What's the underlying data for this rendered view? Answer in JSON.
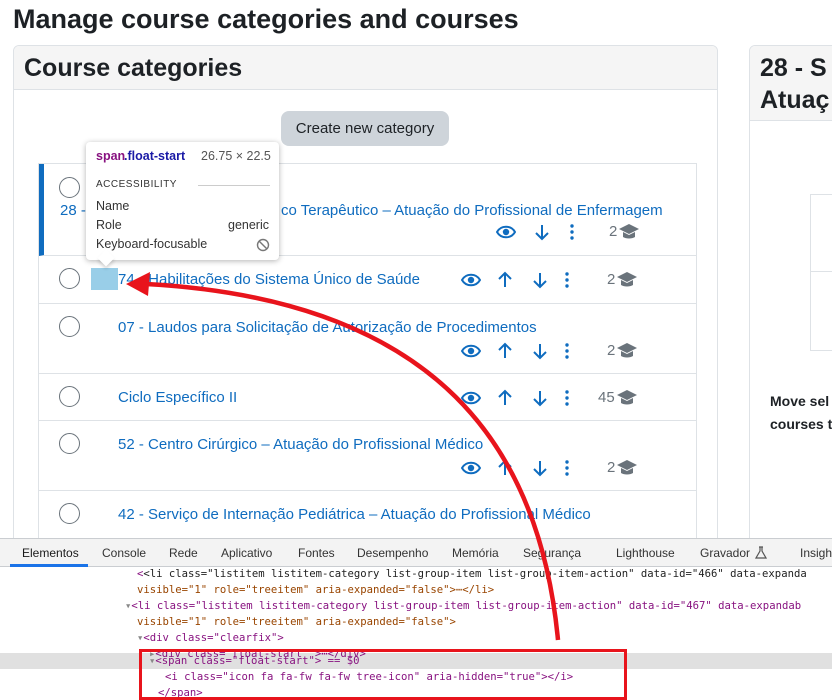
{
  "page": {
    "title": "Manage course categories and courses"
  },
  "categories_panel": {
    "heading": "Course categories",
    "create_button": "Create new category",
    "rows": [
      {
        "name": "28 - Sistematização do Cuidado Terapêutico – Atuação do Profissional de Enfermagem",
        "name_visible_a": "28 -",
        "name_visible_b": "co Terapêutico – Atuação do Profissional de Enfermagem",
        "count": "2",
        "active": true
      },
      {
        "name": "74 - Habilitações do Sistema Único de Saúde",
        "name_visible_a": "74",
        "name_visible_b": "- Habilitações do Sistema Único de Saúde",
        "count": "2"
      },
      {
        "name": "07 - Laudos para Solicitação de Autorização de Procedimentos",
        "count": "2"
      },
      {
        "name": "Ciclo Específico II",
        "count": "45"
      },
      {
        "name": "52 - Centro Cirúrgico – Atuação do Profissional Médico",
        "count": "2"
      },
      {
        "name": "42 - Serviço de Internação Pediátrica – Atuação do Profissional Médico",
        "count": ""
      }
    ]
  },
  "right_panel": {
    "title_line1": "28 - S",
    "title_line2": "Atuaç",
    "move_label_line1": "Move sel",
    "move_label_line2": "courses t"
  },
  "inspect_tooltip": {
    "selector_tag": "span",
    "selector_class": ".float-start",
    "size": "26.75 × 22.5",
    "section": "ACCESSIBILITY",
    "name_label": "Name",
    "role_label": "Role",
    "role_value": "generic",
    "focusable_label": "Keyboard-focusable"
  },
  "devtools": {
    "tabs": [
      "Elementos",
      "Console",
      "Rede",
      "Aplicativo",
      "Fontes",
      "Desempenho",
      "Memória",
      "Segurança",
      "Lighthouse",
      "Gravador",
      "Insigh"
    ],
    "selected_tab": "Elementos",
    "lines": [
      "<li class=\"listitem listitem-category list-group-item list-group-item-action\" data-id=\"466\" data-expanda",
      "visible=\"1\" role=\"treeitem\" aria-expanded=\"false\">⋯</li>",
      "<li class=\"listitem listitem-category list-group-item list-group-item-action\" data-id=\"467\" data-expandab",
      "visible=\"1\" role=\"treeitem\" aria-expanded=\"false\">",
      "<div class=\"clearfix\">",
      "<div class=\"float-start \">⋯</div>",
      "<span class=\"float-start\"> == $0",
      "<i class=\"icon fa fa-fw fa-fw tree-icon\" aria-hidden=\"true\"></i>",
      "</span>"
    ]
  },
  "colors": {
    "link": "#0f6cbf",
    "active_bar": "#0f6cbf",
    "annotation": "#e8141c",
    "highlight": "#8ec9e6"
  }
}
